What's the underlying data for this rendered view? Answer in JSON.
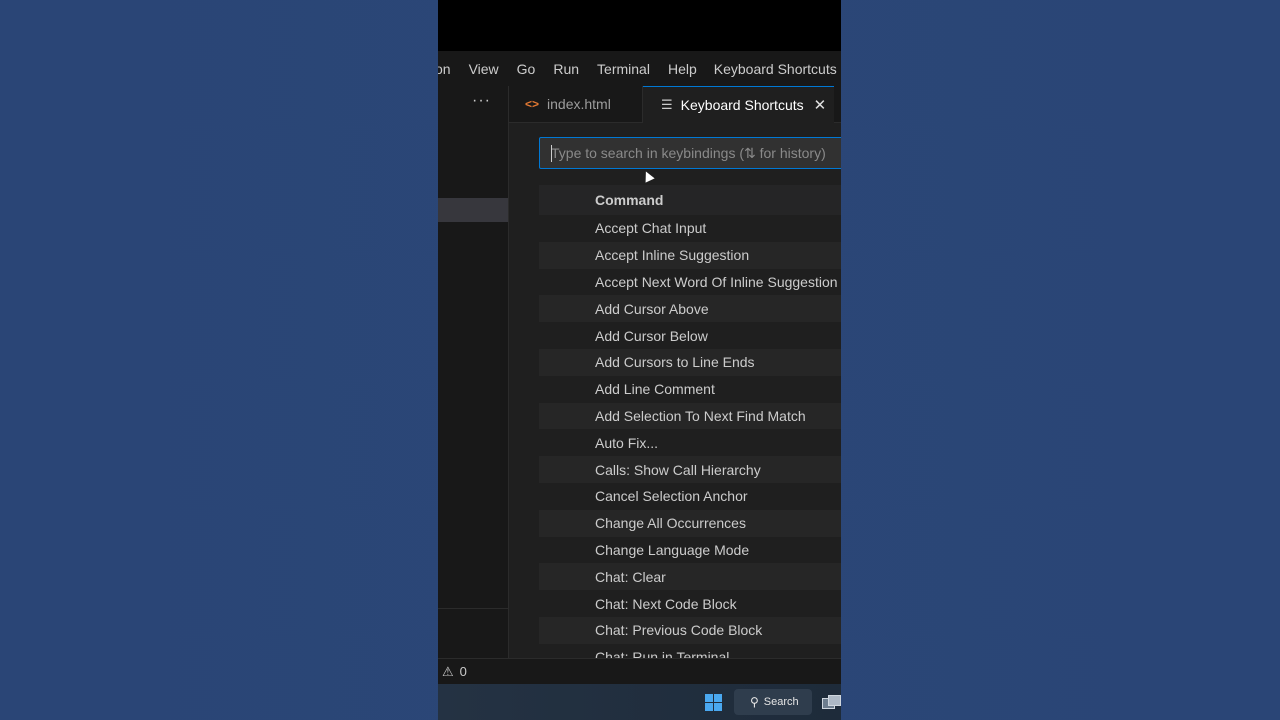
{
  "menubar": {
    "items": [
      "on",
      "View",
      "Go",
      "Run",
      "Terminal",
      "Help"
    ],
    "window_title": "Keyboard Shortcuts -"
  },
  "sidebar": {
    "more_label": "···"
  },
  "tabs": [
    {
      "label": "index.html",
      "icon": "code-icon",
      "active": false
    },
    {
      "label": "Keyboard Shortcuts",
      "icon": "keyboard-list-icon",
      "active": true
    }
  ],
  "search": {
    "value": "",
    "placeholder": "Type to search in keybindings (⇅ for history)"
  },
  "table": {
    "header": "Command",
    "rows": [
      "Accept Chat Input",
      "Accept Inline Suggestion",
      "Accept Next Word Of Inline Suggestion",
      "Add Cursor Above",
      "Add Cursor Below",
      "Add Cursors to Line Ends",
      "Add Line Comment",
      "Add Selection To Next Find Match",
      "Auto Fix...",
      "Calls: Show Call Hierarchy",
      "Cancel Selection Anchor",
      "Change All Occurrences",
      "Change Language Mode",
      "Chat: Clear",
      "Chat: Next Code Block",
      "Chat: Previous Code Block",
      "Chat: Run in Terminal"
    ]
  },
  "statusbar": {
    "warnings": "0"
  },
  "taskbar": {
    "search_label": "Search"
  },
  "colors": {
    "accent": "#0078d4",
    "html_icon": "#e37933"
  }
}
